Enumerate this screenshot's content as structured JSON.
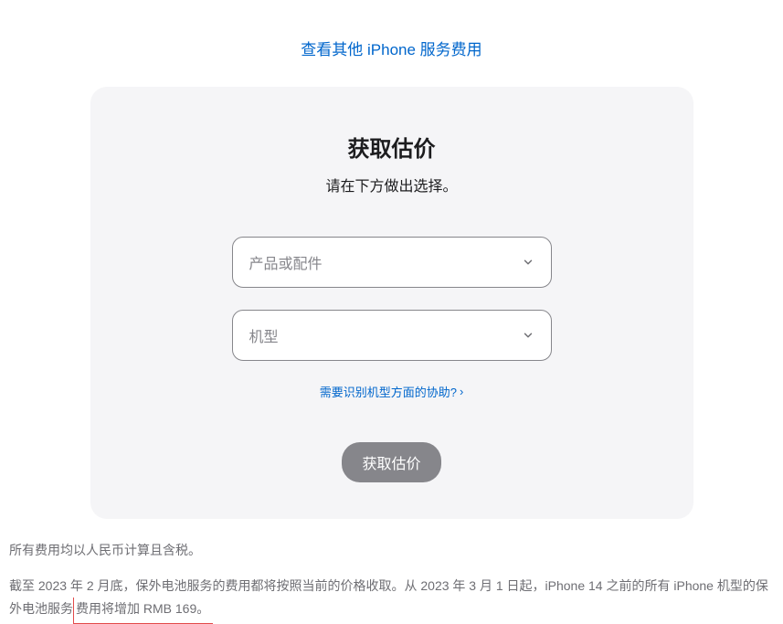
{
  "topLink": {
    "label": "查看其他 iPhone 服务费用"
  },
  "card": {
    "title": "获取估价",
    "subtitle": "请在下方做出选择。",
    "select1": {
      "placeholder": "产品或配件"
    },
    "select2": {
      "placeholder": "机型"
    },
    "helpLink": {
      "label": "需要识别机型方面的协助?"
    },
    "submit": {
      "label": "获取估价"
    }
  },
  "footer": {
    "line1": "所有费用均以人民币计算且含税。",
    "line2_pre": "截至 2023 年 2 月底，保外电池服务的费用都将按照当前的价格收取。从 2023 年 3 月 1 日起，iPhone 14 之前的所有 iPhone 机型的保外电池服务",
    "line2_highlight": "费用将增加 RMB 169。"
  }
}
